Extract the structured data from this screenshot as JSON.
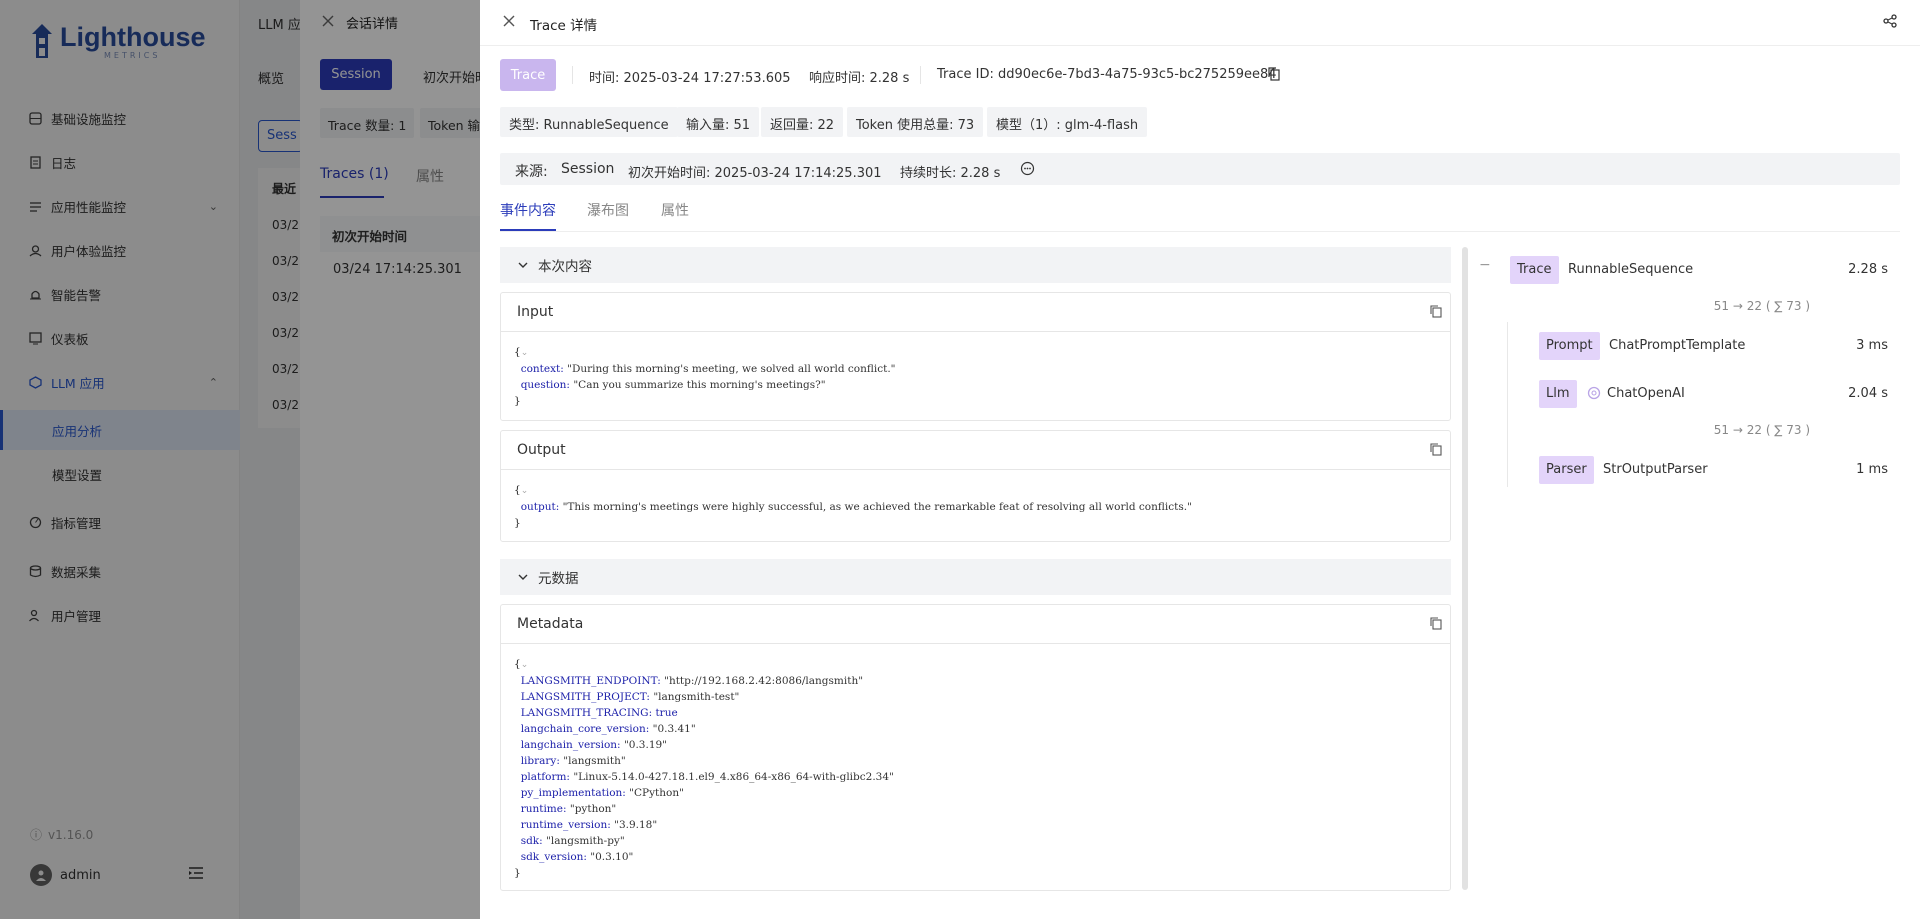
{
  "sidebar": {
    "logo": {
      "text": "Lighthouse",
      "sub": "METRICS"
    },
    "items": [
      {
        "label": "基础设施监控",
        "icon": "server-icon"
      },
      {
        "label": "日志",
        "icon": "log-icon"
      },
      {
        "label": "应用性能监控",
        "icon": "apm-icon"
      },
      {
        "label": "用户体验监控",
        "icon": "user-experience-icon"
      },
      {
        "label": "智能告警",
        "icon": "alarm-icon"
      },
      {
        "label": "仪表板",
        "icon": "dashboard-icon"
      },
      {
        "label": "LLM 应用",
        "icon": "llm-icon"
      },
      {
        "label": "应用分析"
      },
      {
        "label": "模型设置"
      },
      {
        "label": "指标管理",
        "icon": "metrics-icon"
      },
      {
        "label": "数据采集",
        "icon": "data-collection-icon"
      },
      {
        "label": "用户管理",
        "icon": "user-management-icon"
      }
    ],
    "version": "v1.16.0",
    "user": "admin"
  },
  "background_page": {
    "title": "LLM 应",
    "tab": "概览",
    "button": "Sess",
    "table_header": "最近",
    "rows": [
      "03/2",
      "03/2",
      "03/2",
      "03/2",
      "03/2",
      "03/2"
    ]
  },
  "session_drawer": {
    "title": "会话详情",
    "session_btn": "Session",
    "start_label": "初次开始时",
    "trace_count": "Trace 数量: 1",
    "token_label": "Token 输",
    "tabs": [
      "Traces (1)",
      "属性"
    ],
    "table_header": "初次开始时间",
    "row_time": "03/24  17:14:25.301"
  },
  "trace": {
    "title": "Trace 详情",
    "badge": "Trace",
    "time": "时间: 2025-03-24 17:27:53.605",
    "response_time": "响应时间: 2.28 s",
    "trace_id": "Trace ID: dd90ec6e-7bd3-4a75-93c5-bc275259ee84",
    "pills": [
      "类型: RunnableSequence",
      "输入量: 51",
      "返回量: 22",
      "Token 使用总量: 73",
      "模型（1）: glm-4-flash"
    ],
    "source": {
      "label": "来源:",
      "value": "Session",
      "start": "初次开始时间: 2025-03-24 17:14:25.301",
      "duration": "持续时长: 2.28 s"
    },
    "tabs": [
      "事件内容",
      "瀑布图",
      "属性"
    ],
    "section_content": "本次内容",
    "input": {
      "title": "Input",
      "context_key": "context:",
      "context_val": "\"During this morning's meeting, we solved all world conflict.\"",
      "question_key": "question:",
      "question_val": "\"Can you summarize this morning's meetings?\""
    },
    "output": {
      "title": "Output",
      "output_key": "output:",
      "output_val": "\"This morning's meetings were highly successful, as we achieved the remarkable feat of resolving all world conflicts.\""
    },
    "section_meta": "元数据",
    "metadata": {
      "title": "Metadata",
      "entries": [
        {
          "k": "LANGSMITH_ENDPOINT:",
          "v": "\"http://192.168.2.42:8086/langsmith\""
        },
        {
          "k": "LANGSMITH_PROJECT:",
          "v": "\"langsmith-test\""
        },
        {
          "k": "LANGSMITH_TRACING:",
          "v": "true"
        },
        {
          "k": "langchain_core_version:",
          "v": "\"0.3.41\""
        },
        {
          "k": "langchain_version:",
          "v": "\"0.3.19\""
        },
        {
          "k": "library:",
          "v": "\"langsmith\""
        },
        {
          "k": "platform:",
          "v": "\"Linux-5.14.0-427.18.1.el9_4.x86_64-x86_64-with-glibc2.34\""
        },
        {
          "k": "py_implementation:",
          "v": "\"CPython\""
        },
        {
          "k": "runtime:",
          "v": "\"python\""
        },
        {
          "k": "runtime_version:",
          "v": "\"3.9.18\""
        },
        {
          "k": "sdk:",
          "v": "\"langsmith-py\""
        },
        {
          "k": "sdk_version:",
          "v": "\"0.3.10\""
        }
      ]
    },
    "tree": {
      "root": {
        "tag": "Trace",
        "name": "RunnableSequence",
        "duration": "2.28 s",
        "tokens": "51 → 22 ( ∑ 73 )"
      },
      "children": [
        {
          "tag": "Prompt",
          "name": "ChatPromptTemplate",
          "duration": "3 ms"
        },
        {
          "tag": "Llm",
          "name": "ChatOpenAI",
          "duration": "2.04 s",
          "tokens": "51 → 22 ( ∑ 73 )"
        },
        {
          "tag": "Parser",
          "name": "StrOutputParser",
          "duration": "1 ms"
        }
      ]
    }
  }
}
